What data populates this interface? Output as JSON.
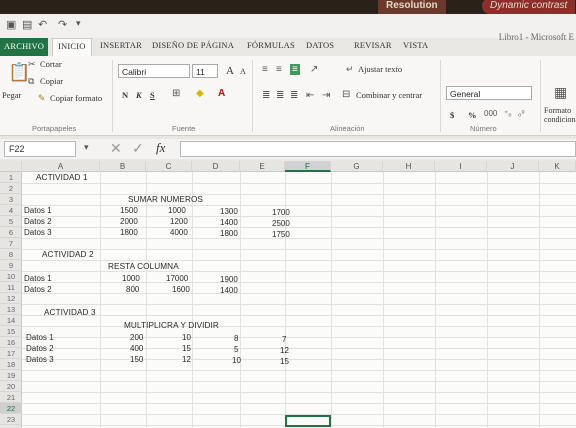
{
  "monitor": {
    "resolution_label": "Resolution",
    "dynamic_contrast_label": "Dynamic contrast"
  },
  "title": "Libro1 - Microsoft E",
  "tabs": [
    {
      "label": "ARCHIVO"
    },
    {
      "label": "INICIO"
    },
    {
      "label": "INSERTAR"
    },
    {
      "label": "DISEÑO DE PÁGINA"
    },
    {
      "label": "FÓRMULAS"
    },
    {
      "label": "DATOS"
    },
    {
      "label": "REVISAR"
    },
    {
      "label": "VISTA"
    }
  ],
  "ribbon": {
    "paste": "Pegar",
    "cut": "Cortar",
    "copy": "Copiar",
    "copy_format": "Copiar formato",
    "clipboard_group": "Portapapeles",
    "font_name": "Calibri",
    "font_size": "11",
    "grow_font": "A",
    "shrink_font": "A",
    "bold": "N",
    "italic": "K",
    "underline": "S",
    "font_group": "Fuente",
    "wrap_text": "Ajustar texto",
    "merge_center": "Combinar y centrar",
    "alignment_group": "Alineación",
    "number_format": "General",
    "currency": "$",
    "percent": "%",
    "number_group": "Número",
    "conditional_format": "Formato condicional"
  },
  "formula_bar": {
    "name_box": "F22",
    "fx": "fx",
    "value": ""
  },
  "columns": [
    "A",
    "B",
    "C",
    "D",
    "E",
    "F",
    "G",
    "H",
    "I",
    "J",
    "K"
  ],
  "rows": [
    "1",
    "2",
    "3",
    "4",
    "5",
    "6",
    "7",
    "8",
    "9",
    "10",
    "11",
    "12",
    "13",
    "14",
    "15",
    "16",
    "17",
    "18",
    "19",
    "20",
    "21",
    "22",
    "23"
  ],
  "cells": {
    "a1": "ACTIVIDAD 1",
    "b2": "SUMAR NUMEROS",
    "r3": [
      "Datos 1",
      "1500",
      "1000",
      "1300",
      "1700"
    ],
    "r4": [
      "Datos 2",
      "2000",
      "1200",
      "1400",
      "2500"
    ],
    "r5": [
      "Datos 3",
      "1800",
      "4000",
      "1800",
      "1750"
    ],
    "a7": "ACTIVIDAD 2",
    "b8": "RESTA COLUMNA",
    "r9": [
      "Datos 1",
      "1000",
      "17000",
      "1900"
    ],
    "r10": [
      "Datos 2",
      "800",
      "1600",
      "1400"
    ],
    "a12": "ACTIVIDAD 3",
    "b13": "MULTIPLICRA Y DIVIDIR",
    "r14": [
      "Datos 1",
      "200",
      "10",
      "8",
      "7"
    ],
    "r15": [
      "Datos 2",
      "400",
      "15",
      "5",
      "12"
    ],
    "r16": [
      "Datos 3",
      "150",
      "12",
      "10",
      "15"
    ]
  }
}
